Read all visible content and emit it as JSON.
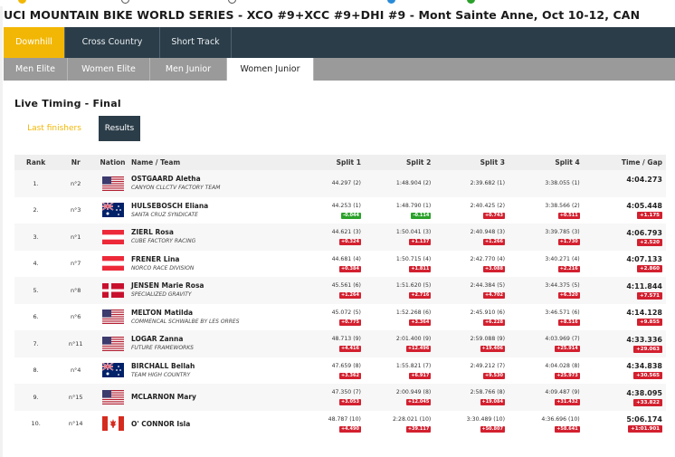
{
  "page": {
    "title": "UCI MOUNTAIN BIKE WORLD SERIES - XCO #9+XCC #9+DHI #9 - Mont Sainte Anne, Oct 10-12, CAN"
  },
  "discipline_tabs": [
    {
      "label": "Downhill",
      "active": true
    },
    {
      "label": "Cross Country",
      "active": false
    },
    {
      "label": "Short Track",
      "active": false
    }
  ],
  "category_tabs": [
    {
      "label": "Men Elite",
      "active": false
    },
    {
      "label": "Women Elite",
      "active": false
    },
    {
      "label": "Men Junior",
      "active": false
    },
    {
      "label": "Women Junior",
      "active": true
    }
  ],
  "live": {
    "title": "Live Timing - Final",
    "last_finishers_label": "Last finishers",
    "results_label": "Results"
  },
  "columns": {
    "rank": "Rank",
    "nr": "Nr",
    "nation": "Nation",
    "name_team": "Name / Team",
    "split1": "Split 1",
    "split2": "Split 2",
    "split3": "Split 3",
    "split4": "Split 4",
    "time_gap": "Time / Gap"
  },
  "colors": {
    "nav_dark": "#2b3d49",
    "accent": "#f2b705",
    "gap_red": "#d3202f",
    "gap_green": "#2aa12a"
  },
  "results": [
    {
      "rank": "1.",
      "nr": "n°2",
      "nation": "USA",
      "flag_icon": "usa-flag-icon",
      "name": "OSTGAARD Aletha",
      "team": "CANYON CLLCTV FACTORY TEAM",
      "s1": "44.297 (2)",
      "s1g": "",
      "s2": "1:48.904 (2)",
      "s2g": "",
      "s3": "2:39.682 (1)",
      "s3g": "",
      "s4": "3:38.055 (1)",
      "s4g": "",
      "time": "4:04.273",
      "gap": ""
    },
    {
      "rank": "2.",
      "nr": "n°3",
      "nation": "AUS",
      "flag_icon": "australia-flag-icon",
      "name": "HULSEBOSCH Eliana",
      "team": "SANTA CRUZ SYNDICATE",
      "s1": "44.253 (1)",
      "s1g": "-0.044",
      "s2": "1:48.790 (1)",
      "s2g": "-0.114",
      "s3": "2:40.425 (2)",
      "s3g": "+0.743",
      "s4": "3:38.566 (2)",
      "s4g": "+0.511",
      "time": "4:05.448",
      "gap": "+1.175"
    },
    {
      "rank": "3.",
      "nr": "n°1",
      "nation": "AUT",
      "flag_icon": "austria-flag-icon",
      "name": "ZIERL Rosa",
      "team": "CUBE FACTORY RACING",
      "s1": "44.621 (3)",
      "s1g": "+0.324",
      "s2": "1:50.041 (3)",
      "s2g": "+1.137",
      "s3": "2:40.948 (3)",
      "s3g": "+1.266",
      "s4": "3:39.785 (3)",
      "s4g": "+1.730",
      "time": "4:06.793",
      "gap": "+2.520"
    },
    {
      "rank": "4.",
      "nr": "n°7",
      "nation": "AUT",
      "flag_icon": "austria-flag-icon",
      "name": "FRENER Lina",
      "team": "NORCO RACE DIVISION",
      "s1": "44.681 (4)",
      "s1g": "+0.384",
      "s2": "1:50.715 (4)",
      "s2g": "+1.811",
      "s3": "2:42.770 (4)",
      "s3g": "+3.088",
      "s4": "3:40.271 (4)",
      "s4g": "+2.216",
      "time": "4:07.133",
      "gap": "+2.860"
    },
    {
      "rank": "5.",
      "nr": "n°8",
      "nation": "DEN",
      "flag_icon": "denmark-flag-icon",
      "name": "JENSEN Marie Rosa",
      "team": "SPECIALIZED GRAVITY",
      "s1": "45.561 (6)",
      "s1g": "+1.264",
      "s2": "1:51.620 (5)",
      "s2g": "+2.716",
      "s3": "2:44.384 (5)",
      "s3g": "+4.702",
      "s4": "3:44.375 (5)",
      "s4g": "+6.320",
      "time": "4:11.844",
      "gap": "+7.571"
    },
    {
      "rank": "6.",
      "nr": "n°6",
      "nation": "USA",
      "flag_icon": "usa-flag-icon",
      "name": "MELTON Matilda",
      "team": "COMMENCAL SCHWALBE BY LES ORRES",
      "s1": "45.072 (5)",
      "s1g": "+0.775",
      "s2": "1:52.268 (6)",
      "s2g": "+3.364",
      "s3": "2:45.910 (6)",
      "s3g": "+6.228",
      "s4": "3:46.571 (6)",
      "s4g": "+8.516",
      "time": "4:14.128",
      "gap": "+9.855"
    },
    {
      "rank": "7.",
      "nr": "n°11",
      "nation": "USA",
      "flag_icon": "usa-flag-icon",
      "name": "LOGAR Zanna",
      "team": "FUTURE FRAMEWORKS",
      "s1": "48.713 (9)",
      "s1g": "+4.416",
      "s2": "2:01.400 (9)",
      "s2g": "+12.496",
      "s3": "2:59.088 (9)",
      "s3g": "+19.406",
      "s4": "4:03.969 (7)",
      "s4g": "+25.914",
      "time": "4:33.336",
      "gap": "+29.063"
    },
    {
      "rank": "8.",
      "nr": "n°4",
      "nation": "AUS",
      "flag_icon": "australia-flag-icon",
      "name": "BIRCHALL Bellah",
      "team": "TEAM HIGH COUNTRY",
      "s1": "47.659 (8)",
      "s1g": "+3.362",
      "s2": "1:55.821 (7)",
      "s2g": "+6.917",
      "s3": "2:49.212 (7)",
      "s3g": "+9.530",
      "s4": "4:04.028 (8)",
      "s4g": "+25.973",
      "time": "4:34.838",
      "gap": "+30.565"
    },
    {
      "rank": "9.",
      "nr": "n°15",
      "nation": "USA",
      "flag_icon": "usa-flag-icon",
      "name": "MCLARNON Mary",
      "team": "",
      "s1": "47.350 (7)",
      "s1g": "+3.053",
      "s2": "2:00.949 (8)",
      "s2g": "+12.045",
      "s3": "2:58.766 (8)",
      "s3g": "+19.084",
      "s4": "4:09.487 (9)",
      "s4g": "+31.432",
      "time": "4:38.095",
      "gap": "+33.822"
    },
    {
      "rank": "10.",
      "nr": "n°14",
      "nation": "CAN",
      "flag_icon": "canada-flag-icon",
      "name": "O' CONNOR Isla",
      "team": "",
      "s1": "48.787 (10)",
      "s1g": "+4.490",
      "s2": "2:28.021 (10)",
      "s2g": "+39.117",
      "s3": "3:30.489 (10)",
      "s3g": "+50.807",
      "s4": "4:36.696 (10)",
      "s4g": "+58.641",
      "time": "5:06.174",
      "gap": "+1:01.901"
    }
  ]
}
